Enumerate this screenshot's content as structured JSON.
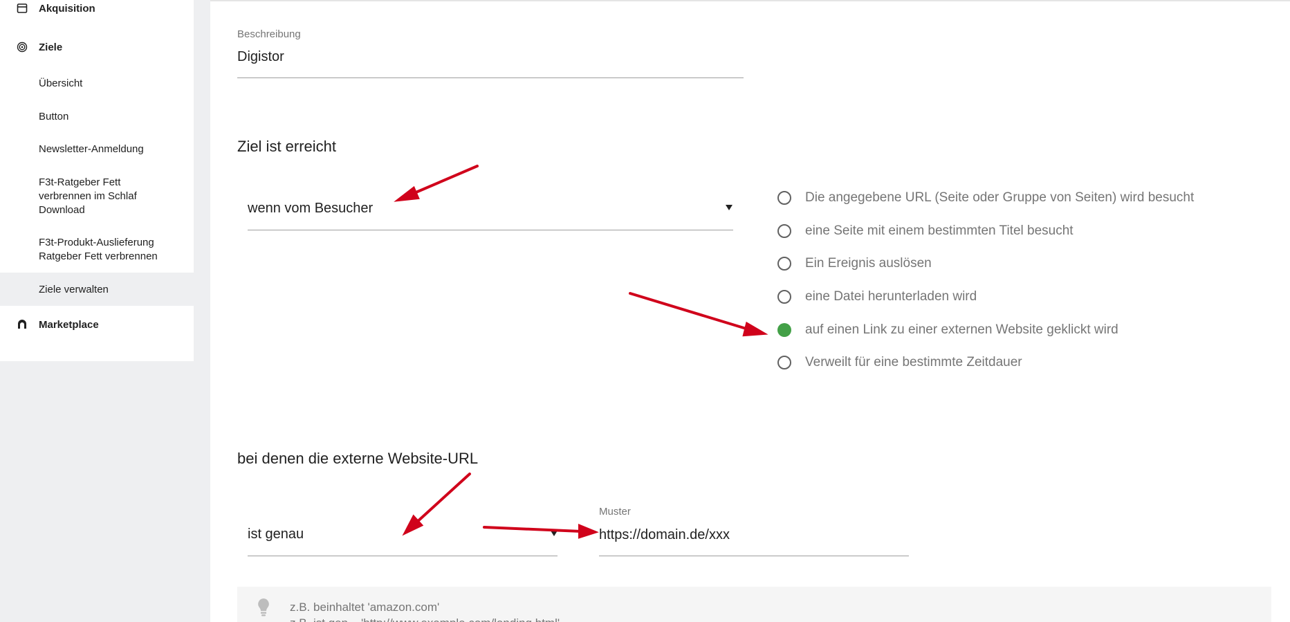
{
  "sidebar": {
    "items": [
      {
        "label": "Akquisition"
      },
      {
        "label": "Ziele"
      },
      {
        "label": "Übersicht"
      },
      {
        "label": "Button"
      },
      {
        "label": "Newsletter-Anmeldung"
      },
      {
        "label": "F3t-Ratgeber Fett verbrennen im Schlaf Download"
      },
      {
        "label": "F3t-Produkt-Auslieferung Ratgeber Fett verbrennen"
      },
      {
        "label": "Ziele verwalten"
      },
      {
        "label": "Marketplace"
      }
    ]
  },
  "form": {
    "description_label": "Beschreibung",
    "description_value": "Digistor",
    "goal_reached_title": "Ziel ist erreicht",
    "trigger_select_value": "wenn vom Besucher",
    "radio_options": [
      {
        "label": "Die angegebene URL (Seite oder Gruppe von Seiten) wird besucht",
        "checked": false
      },
      {
        "label": "eine Seite mit einem bestimmten Titel besucht",
        "checked": false
      },
      {
        "label": "Ein Ereignis auslösen",
        "checked": false
      },
      {
        "label": "eine Datei herunterladen wird",
        "checked": false
      },
      {
        "label": "auf einen Link zu einer externen Website geklickt wird",
        "checked": true
      },
      {
        "label": "Verweilt für eine bestimmte Zeitdauer",
        "checked": false
      }
    ],
    "external_url_title": "bei denen die externe Website-URL",
    "match_select_value": "ist genau",
    "pattern_label": "Muster",
    "pattern_value": "https://domain.de/xxx",
    "hint_line1": "z.B. beinhaltet 'amazon.com'",
    "hint_line2": "z.B. ist gen... 'http://www.example.com/landing.html'"
  },
  "colors": {
    "accent_green": "#43a047",
    "annotation_red": "#d0021b"
  }
}
